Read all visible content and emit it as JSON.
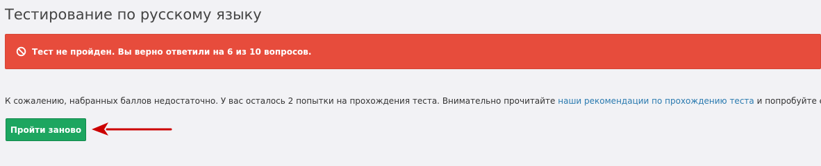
{
  "header": {
    "title": "Тестирование по русскому языку"
  },
  "alert": {
    "icon": "ban-icon",
    "text": "Тест не пройден. Вы верно ответили на 6 из 10 вопросов.",
    "background_color": "#e74c3c",
    "text_color": "#ffffff"
  },
  "message": {
    "before_link": "К сожалению, набранных баллов недостаточно. У вас осталось 2 попытки на прохождения теста. Внимательно прочитайте ",
    "link_text": "наши рекомендации по прохождению теста",
    "after_link": " и попробуйте еще раз!",
    "link_color": "#2a7aaf"
  },
  "retry_button": {
    "label": "Пройти заново",
    "background_color": "#1da660"
  },
  "annotation": {
    "icon": "pointer-arrow-icon",
    "color": "#cc0000"
  }
}
